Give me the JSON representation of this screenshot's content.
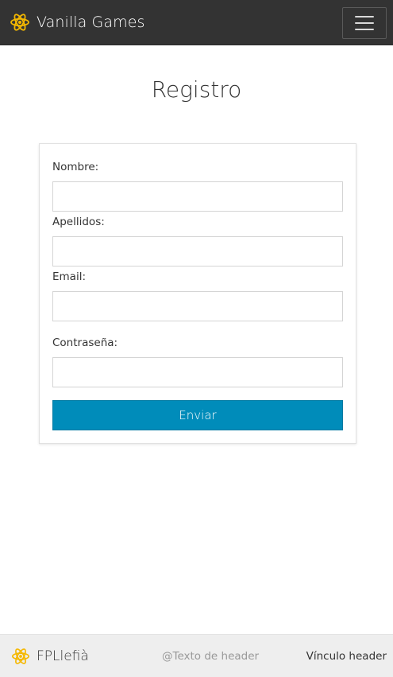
{
  "navbar": {
    "brand_name": "Vanilla Games",
    "brand_icon": "atom-icon",
    "toggle_icon": "hamburger-menu-icon",
    "background": "#333333"
  },
  "main": {
    "title": "Registro"
  },
  "form": {
    "fields": [
      {
        "label": "Nombre:",
        "value": "",
        "placeholder": ""
      },
      {
        "label": "Apellidos:",
        "value": "",
        "placeholder": ""
      },
      {
        "label": "Email:",
        "value": "",
        "placeholder": ""
      },
      {
        "label": "Contraseña:",
        "value": "",
        "placeholder": ""
      }
    ],
    "submit_label": "Enviar",
    "submit_color": "#008cba"
  },
  "footer": {
    "brand_name": "FPLlefià",
    "brand_icon": "atom-icon",
    "text": "@Texto de header",
    "link": "Vínculo header"
  },
  "colors": {
    "accent": "#f5b800"
  }
}
